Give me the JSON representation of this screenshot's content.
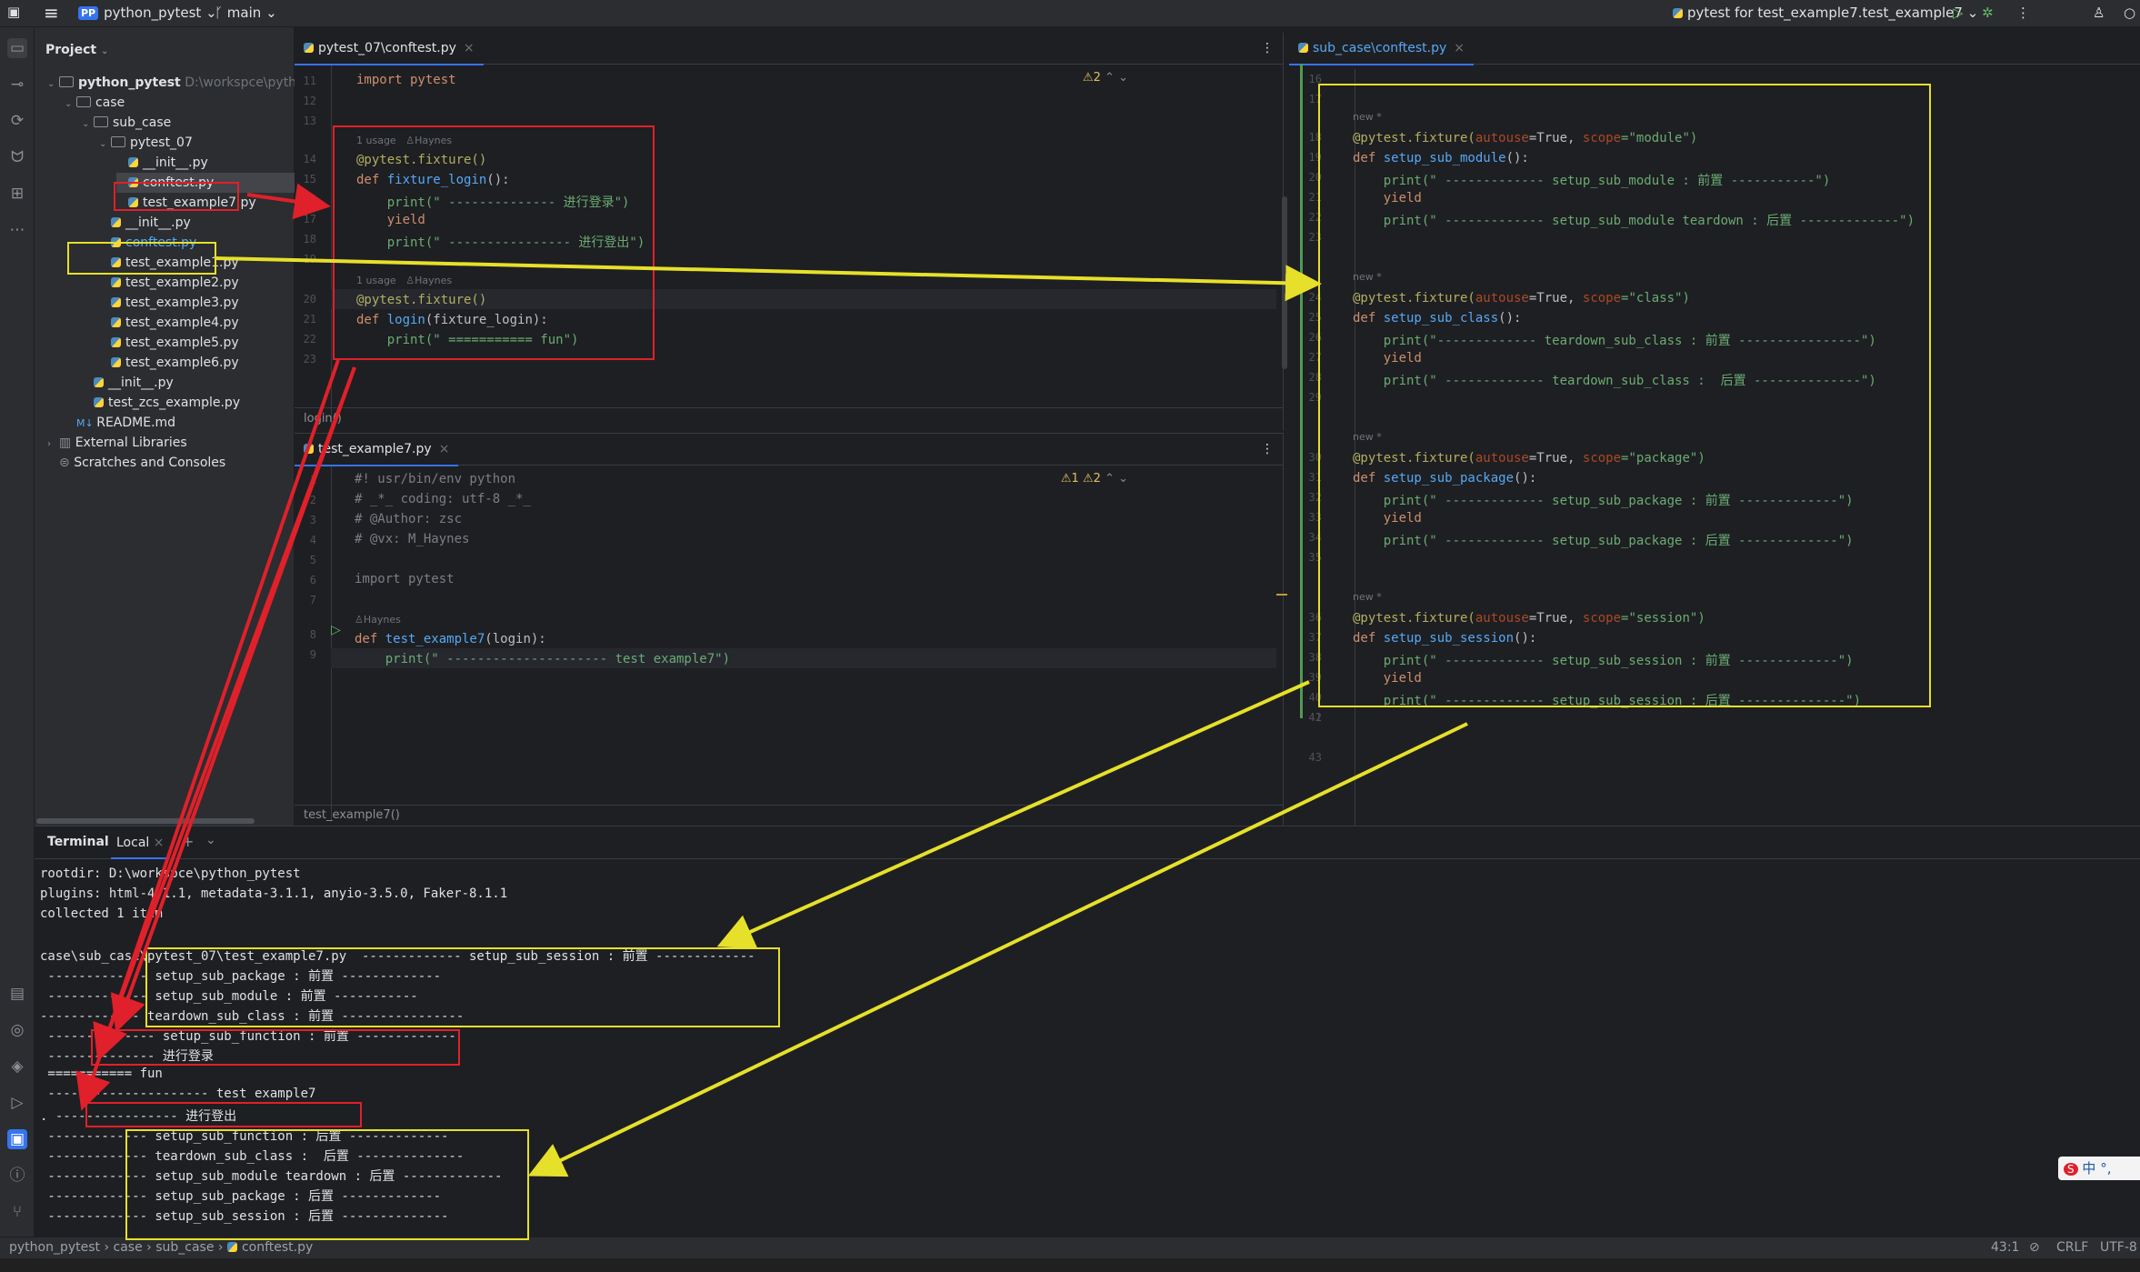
{
  "toolbar": {
    "project_badge": "PP",
    "project_name": "python_pytest",
    "branch": "main",
    "run_config": "pytest for test_example7.test_example7"
  },
  "project_panel": {
    "title": "Project",
    "root": "python_pytest",
    "root_path": "D:\\workspce\\python_pytest",
    "items": [
      {
        "label": "case",
        "type": "folder"
      },
      {
        "label": "sub_case",
        "type": "folder"
      },
      {
        "label": "pytest_07",
        "type": "folder"
      },
      {
        "label": "__init__.py",
        "type": "py"
      },
      {
        "label": "conftest.py",
        "type": "py"
      },
      {
        "label": "test_example7.py",
        "type": "py"
      },
      {
        "label": "__init__.py",
        "type": "py"
      },
      {
        "label": "conftest.py",
        "type": "py"
      },
      {
        "label": "test_example1.py",
        "type": "py"
      },
      {
        "label": "test_example2.py",
        "type": "py"
      },
      {
        "label": "test_example3.py",
        "type": "py"
      },
      {
        "label": "test_example4.py",
        "type": "py"
      },
      {
        "label": "test_example5.py",
        "type": "py"
      },
      {
        "label": "test_example6.py",
        "type": "py"
      },
      {
        "label": "__init__.py",
        "type": "py"
      },
      {
        "label": "test_zcs_example.py",
        "type": "py"
      },
      {
        "label": "README.md",
        "type": "md"
      },
      {
        "label": "External Libraries",
        "type": "lib"
      },
      {
        "label": "Scratches and Consoles",
        "type": "scratch"
      }
    ]
  },
  "editor1": {
    "tab": "pytest_07\\conftest.py",
    "warnings": "2",
    "breadcrumb": "login()",
    "line_numbers": [
      "11",
      "12",
      "13",
      "14",
      "15",
      "16",
      "17",
      "18",
      "19",
      "20",
      "21",
      "22",
      "23"
    ],
    "hint1_usage": "1 usage",
    "hint1_author": "Haynes",
    "hint2_usage": "1 usage",
    "hint2_author": "Haynes",
    "code": {
      "l11": "import pytest",
      "l14": "@pytest.fixture()",
      "l15_def": "def ",
      "l15_fn": "fixture_login",
      "l15_rest": "():",
      "l16": "    print(\" -------------- 进行登录\")",
      "l17": "    yield",
      "l18": "    print(\" ---------------- 进行登出\")",
      "l20": "@pytest.fixture()",
      "l21_def": "def ",
      "l21_fn": "login",
      "l21_rest": "(fixture_login):",
      "l22": "    print(\" =========== fun\")"
    }
  },
  "editor2": {
    "tab": "test_example7.py",
    "warn1": "1",
    "warn2": "2",
    "breadcrumb": "test_example7()",
    "line_numbers": [
      "1",
      "2",
      "3",
      "4",
      "5",
      "6",
      "7",
      "8",
      "9"
    ],
    "hint_author": "Haynes",
    "code": {
      "l1": "#! usr/bin/env python",
      "l2": "# _*_ coding: utf-8 _*_",
      "l3": "# @Author: zsc",
      "l4": "# @vx: M_Haynes",
      "l6": "import pytest",
      "l8_def": "def ",
      "l8_fn": "test_example7",
      "l8_rest": "(login):",
      "l9": "    print(\" --------------------- test example7\")"
    }
  },
  "editor3": {
    "tab": "sub_case\\conftest.py",
    "line_numbers": [
      "16",
      "17",
      "18",
      "19",
      "20",
      "21",
      "22",
      "23",
      "24",
      "25",
      "26",
      "27",
      "28",
      "29",
      "30",
      "31",
      "32",
      "33",
      "34",
      "35",
      "36",
      "37",
      "38",
      "39",
      "40",
      "41",
      "42",
      "43"
    ],
    "hint": "new *",
    "blocks": [
      {
        "deco": "@pytest.fixture(",
        "autouse": "autouse",
        "mid": "=True, ",
        "scope": "scope",
        "scope_val": "=\"module\")",
        "def": "def ",
        "fn": "setup_sub_module",
        "tail": "():",
        "p1": "    print(\" ------------- setup_sub_module : 前置 -----------\")",
        "y": "    yield",
        "p2": "    print(\" ------------- setup_sub_module teardown : 后置 -------------\")"
      },
      {
        "deco": "@pytest.fixture(",
        "autouse": "autouse",
        "mid": "=True, ",
        "scope": "scope",
        "scope_val": "=\"class\")",
        "def": "def ",
        "fn": "setup_sub_class",
        "tail": "():",
        "p1": "    print(\"------------- teardown_sub_class : 前置 ----------------\")",
        "y": "    yield",
        "p2": "    print(\" ------------- teardown_sub_class :  后置 --------------\")"
      },
      {
        "deco": "@pytest.fixture(",
        "autouse": "autouse",
        "mid": "=True, ",
        "scope": "scope",
        "scope_val": "=\"package\")",
        "def": "def ",
        "fn": "setup_sub_package",
        "tail": "():",
        "p1": "    print(\" ------------- setup_sub_package : 前置 -------------\")",
        "y": "    yield",
        "p2": "    print(\" ------------- setup_sub_package : 后置 -------------\")"
      },
      {
        "deco": "@pytest.fixture(",
        "autouse": "autouse",
        "mid": "=True, ",
        "scope": "scope",
        "scope_val": "=\"session\")",
        "def": "def ",
        "fn": "setup_sub_session",
        "tail": "():",
        "p1": "    print(\" ------------- setup_sub_session : 前置 -------------\")",
        "y": "    yield",
        "p2": "    print(\" ------------- setup_sub_session : 后置 --------------\")"
      }
    ]
  },
  "terminal": {
    "tab_terminal": "Terminal",
    "tab_local": "Local",
    "lines": [
      "rootdir: D:\\workspce\\python_pytest",
      "plugins: html-4.1.1, metadata-3.1.1, anyio-3.5.0, Faker-8.1.1",
      "collected 1 item",
      "",
      "case\\sub_case\\pytest_07\\test_example7.py  ------------- setup_sub_session : 前置 -------------",
      " ------------- setup_sub_package : 前置 -------------",
      " ------------- setup_sub_module : 前置 -----------",
      "------------- teardown_sub_class : 前置 ----------------",
      " -------------- setup_sub_function : 前置 -------------",
      " -------------- 进行登录",
      " =========== fun",
      " --------------------- test example7",
      ". ---------------- 进行登出",
      " ------------- setup_sub_function : 后置 -------------",
      " ------------- teardown_sub_class :  后置 --------------",
      " ------------- setup_sub_module teardown : 后置 -------------",
      " ------------- setup_sub_package : 后置 -------------",
      " ------------- setup_sub_session : 后置 --------------"
    ]
  },
  "statusbar": {
    "crumbs": [
      "python_pytest",
      "case",
      "sub_case",
      "conftest.py"
    ],
    "position": "43:1",
    "line_sep": "CRLF",
    "encoding": "UTF-8"
  },
  "ime": {
    "label": "中"
  },
  "colors": {
    "annotation_red": "#e0202a",
    "annotation_yellow": "#e6e02a",
    "accent": "#3574f0"
  }
}
